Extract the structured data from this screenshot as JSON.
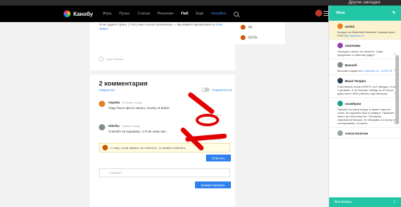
{
  "browser": {
    "bookmarks": [
      "Другие закладки"
    ]
  },
  "header": {
    "logo_text": "Канобу",
    "nav": [
      "Игры",
      "Пульс",
      "Статьи",
      "Решение",
      "Паб",
      "Ещё",
      "Headline"
    ]
  },
  "intro_text": "И не судите строго :) Что у нас в итоге получилось — вы можете просмотреть в",
  "intro_link": "этом видео",
  "side_rows": [
    {
      "count": "49"
    },
    {
      "name": "GOTe"
    }
  ],
  "reaction_label": "Будь первым",
  "comments": {
    "title": "2 комментария",
    "sort_label": "Сверху все",
    "subscribe_label": "Подписаться!",
    "items": [
      {
        "author": "Кирийа",
        "time": "10 минут назад",
        "text": "Надо было просто кинуть ссылку. В войти.",
        "actions": "Ответить"
      },
      {
        "author": "Nikelka",
        "time": "5 минут назад",
        "text": "Спасибо за подсказку =) Я же знаю про...",
        "actions": "Ответить"
      }
    ],
    "reply_placeholder": "А еще, если нажать на ответить, то можно ответить.",
    "reply_button": "Ответить",
    "new_placeholder": "Говорит?",
    "new_button": "Комментировать"
  },
  "panel": {
    "title": "Wow",
    "items": [
      {
        "author": "aneis1",
        "text": "Конкурс по Battlefield Hardline! Главный приз - PS4!",
        "link": "http://kanobu.ru/...",
        "count": "",
        "highlight": true
      },
      {
        "author": "VOSTORG",
        "text": "Никогда и ничего не просите. Сами предложат и сами все дадут!",
        "count": "5",
        "highlight": false
      },
      {
        "author": "Basuchi",
        "text": "Высшая стадия сел",
        "link": "u.kanobu.ru/...1075778",
        "count": "5",
        "highlight": false
      },
      {
        "author": "Black Templar",
        "text": "3 миллиона очков в ЮЛТС на 3 звезды с 3 из 4 уровень. А за богатую победу по 40 лечат даже всего 200к (обычно еще меньше)",
        "count": "3",
        "highlight": false
      },
      {
        "author": "vovwftyme",
        "text": "Пришёл на пасту вокруг в замен пороги в стене. Во времени был в универе. Привезёт много на почту мну нет. Телефону, спиральной мышки, не обходимо и в кучку от тестирования. Отлично.",
        "count": "5",
        "highlight": false
      },
      {
        "author": "Алеся Колотин",
        "text": "",
        "count": "",
        "highlight": false
      }
    ],
    "footer_label": "Все волны",
    "footer_count": "1"
  }
}
